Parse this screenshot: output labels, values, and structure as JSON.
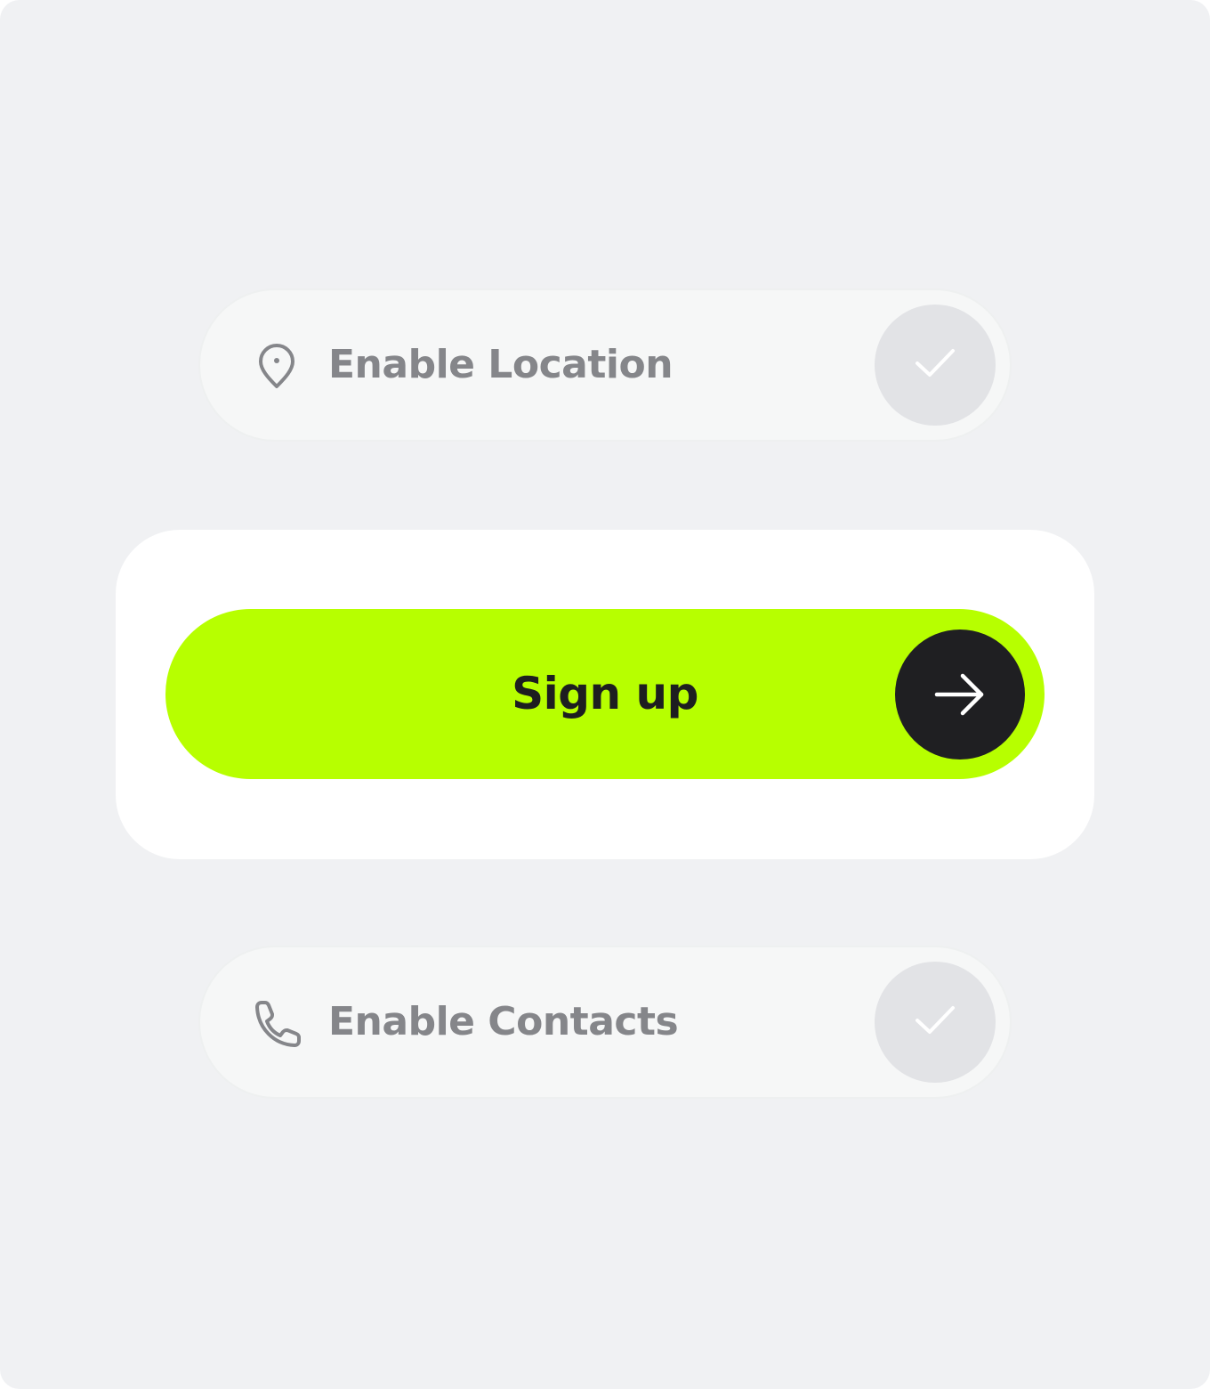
{
  "location_toggle": {
    "label": "Enable Location",
    "icon": "map-pin-icon",
    "checked": false
  },
  "signup": {
    "label": "Sign up",
    "icon": "arrow-right-icon"
  },
  "contacts_toggle": {
    "label": "Enable Contacts",
    "icon": "phone-icon",
    "checked": false
  },
  "colors": {
    "background": "#f0f1f3",
    "accent": "#b7ff00",
    "dark": "#1f1f22",
    "muted_text": "#85868a",
    "check_circle": "#e2e3e6"
  }
}
